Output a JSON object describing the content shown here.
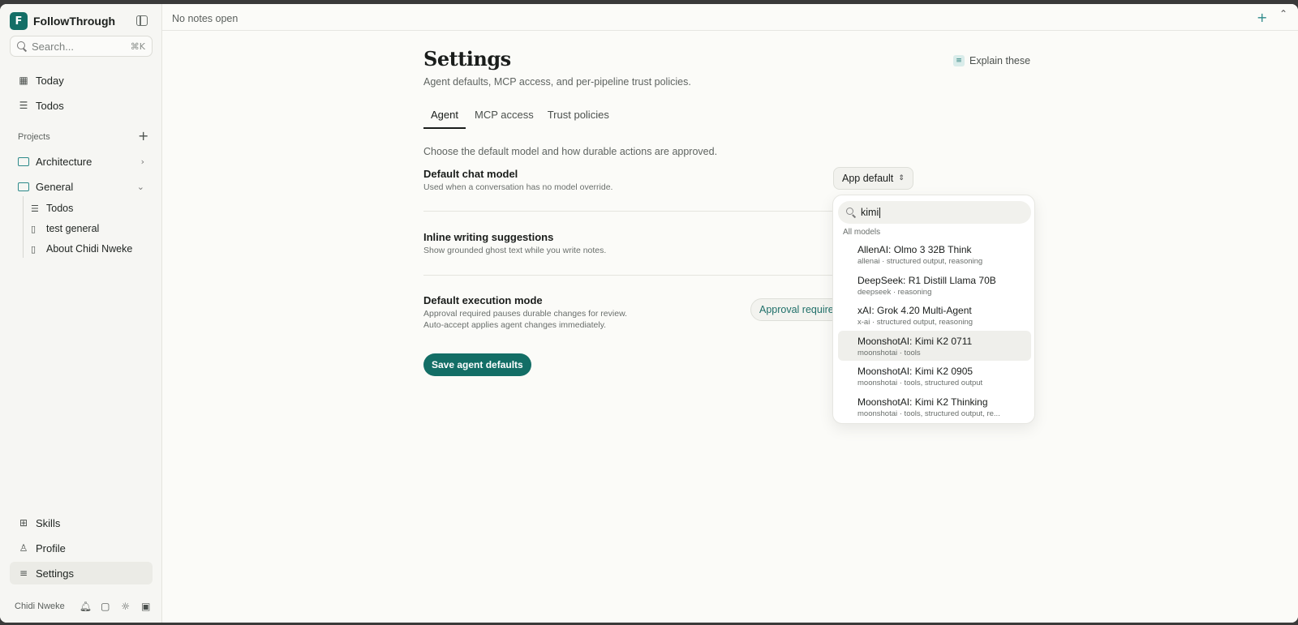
{
  "app": {
    "name": "FollowThrough",
    "logo_text": "F"
  },
  "sidebar": {
    "search_placeholder": "Search...",
    "search_shortcut": "⌘K",
    "nav": [
      {
        "label": "Today",
        "icon": "calendar-icon"
      },
      {
        "label": "Todos",
        "icon": "checklist-icon"
      }
    ],
    "projects_label": "Projects",
    "projects": [
      {
        "label": "Architecture",
        "expanded": false
      },
      {
        "label": "General",
        "expanded": true
      }
    ],
    "general_children": [
      {
        "label": "Todos",
        "icon": "checklist-icon"
      },
      {
        "label": "test general",
        "icon": "document-icon"
      },
      {
        "label": "About Chidi Nweke",
        "icon": "document-icon"
      }
    ],
    "bottom_nav": [
      {
        "label": "Skills",
        "icon": "grid-icon"
      },
      {
        "label": "Profile",
        "icon": "user-icon"
      },
      {
        "label": "Settings",
        "icon": "sliders-icon",
        "active": true
      }
    ],
    "user_name": "Chidi Nweke"
  },
  "topbar": {
    "text": "No notes open"
  },
  "settings": {
    "title": "Settings",
    "subtitle": "Agent defaults, MCP access, and per-pipeline trust policies.",
    "explain_label": "Explain these",
    "tabs": [
      {
        "label": "Agent",
        "active": true
      },
      {
        "label": "MCP access",
        "active": false
      },
      {
        "label": "Trust policies",
        "active": false
      }
    ],
    "description": "Choose the default model and how durable actions are approved.",
    "default_model": {
      "title": "Default chat model",
      "hint": "Used when a conversation has no model override.",
      "value": "App default"
    },
    "inline_suggestions": {
      "title": "Inline writing suggestions",
      "hint": "Show grounded ghost text while you write notes."
    },
    "execution_mode": {
      "title": "Default execution mode",
      "hint_line1": "Approval required pauses durable changes for review.",
      "hint_line2": "Auto-accept applies agent changes immediately.",
      "value": "Approval required"
    },
    "save_label": "Save agent defaults"
  },
  "model_dropdown": {
    "search_value": "kimi",
    "group_label": "All models",
    "items": [
      {
        "name": "AllenAI: Olmo 3 32B Think",
        "meta": "allenai · structured output, reasoning",
        "highlighted": false
      },
      {
        "name": "DeepSeek: R1 Distill Llama 70B",
        "meta": "deepseek · reasoning",
        "highlighted": false
      },
      {
        "name": "xAI: Grok 4.20 Multi-Agent",
        "meta": "x-ai · structured output, reasoning",
        "highlighted": false
      },
      {
        "name": "MoonshotAI: Kimi K2 0711",
        "meta": "moonshotai · tools",
        "highlighted": true
      },
      {
        "name": "MoonshotAI: Kimi K2 0905",
        "meta": "moonshotai · tools, structured output",
        "highlighted": false
      },
      {
        "name": "MoonshotAI: Kimi K2 Thinking",
        "meta": "moonshotai · tools, structured output, re...",
        "highlighted": false
      }
    ]
  },
  "colors": {
    "accent": "#136e66",
    "background": "#fbfbf8",
    "sidebar": "#f6f6f3"
  }
}
